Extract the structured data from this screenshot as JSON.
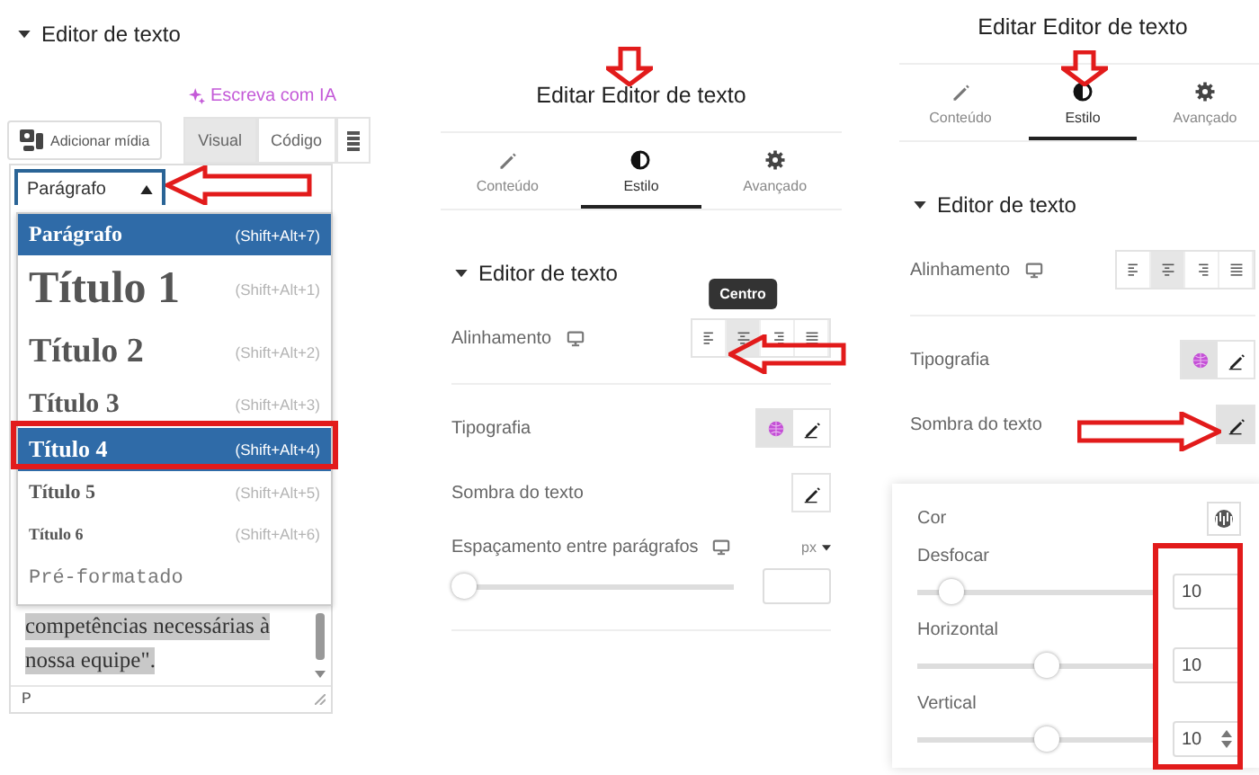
{
  "editor": {
    "title": "Editor de texto",
    "ai_link": "Escreva com IA",
    "media_button": "Adicionar mídia",
    "mode_tabs": [
      {
        "label": "Visual",
        "selected": true
      },
      {
        "label": "Código",
        "selected": false
      }
    ],
    "format_select": "Parágrafo",
    "format_menu": [
      {
        "kind": "p",
        "label": "Parágrafo",
        "shortcut": "(Shift+Alt+7)",
        "highlighted": true
      },
      {
        "kind": "h1",
        "label": "Título 1",
        "shortcut": "(Shift+Alt+1)",
        "highlighted": false
      },
      {
        "kind": "h2",
        "label": "Título 2",
        "shortcut": "(Shift+Alt+2)",
        "highlighted": false
      },
      {
        "kind": "h3",
        "label": "Título 3",
        "shortcut": "(Shift+Alt+3)",
        "highlighted": false
      },
      {
        "kind": "h4",
        "label": "Título 4",
        "shortcut": "(Shift+Alt+4)",
        "highlighted": true
      },
      {
        "kind": "h5",
        "label": "Título 5",
        "shortcut": "(Shift+Alt+5)",
        "highlighted": false
      },
      {
        "kind": "h6",
        "label": "Título 6",
        "shortcut": "(Shift+Alt+6)",
        "highlighted": false
      },
      {
        "kind": "pre",
        "label": "Pré-formatado",
        "highlighted": false
      }
    ],
    "content_lines": [
      "competências necessárias à",
      "nossa equipe\"."
    ],
    "status": "P"
  },
  "style_panels": [
    {
      "title": "Editar Editor de texto",
      "tabs": [
        {
          "kind": "content",
          "label": "Conteúdo",
          "selected": false
        },
        {
          "kind": "style",
          "label": "Estilo",
          "selected": true
        },
        {
          "kind": "advanced",
          "label": "Avançado",
          "selected": false
        }
      ],
      "section": "Editor de texto",
      "rows": [
        {
          "kind": "align",
          "label": "Alinhamento",
          "buttons": [
            {
              "kind": "left",
              "selected": false
            },
            {
              "kind": "center",
              "selected": true,
              "tooltip": "Centro"
            },
            {
              "kind": "right",
              "selected": false
            },
            {
              "kind": "justify",
              "selected": false
            }
          ]
        },
        {
          "kind": "actions",
          "label": "Tipografia",
          "buttons": [
            {
              "kind": "global",
              "active": true
            },
            {
              "kind": "edit",
              "active": false
            }
          ]
        },
        {
          "kind": "actions",
          "label": "Sombra do texto",
          "buttons": [
            {
              "kind": "edit",
              "active": false
            }
          ]
        },
        {
          "kind": "spacing",
          "label": "Espaçamento entre parágrafos",
          "unit": "px",
          "level": 0
        }
      ]
    },
    {
      "title": "Editar Editor de texto",
      "tabs": [
        {
          "kind": "content",
          "label": "Conteúdo",
          "selected": false
        },
        {
          "kind": "style",
          "label": "Estilo",
          "selected": true
        },
        {
          "kind": "advanced",
          "label": "Avançado",
          "selected": false
        }
      ],
      "section": "Editor de texto",
      "rows": [
        {
          "kind": "align",
          "label": "Alinhamento",
          "buttons": [
            {
              "kind": "left",
              "selected": false
            },
            {
              "kind": "center",
              "selected": true
            },
            {
              "kind": "right",
              "selected": false
            },
            {
              "kind": "justify",
              "selected": false
            }
          ]
        },
        {
          "kind": "actions",
          "label": "Tipografia",
          "buttons": [
            {
              "kind": "global",
              "active": true
            },
            {
              "kind": "edit",
              "active": false
            }
          ]
        },
        {
          "kind": "actions",
          "label": "Sombra do texto",
          "buttons": [
            {
              "kind": "edit",
              "active": true
            }
          ]
        },
        {
          "kind": "popover",
          "fields": [
            {
              "kind": "color",
              "label": "Cor"
            },
            {
              "kind": "slider",
              "label": "Desfocar",
              "level": 0.1,
              "value": "10",
              "stepper": false
            },
            {
              "kind": "slider",
              "label": "Horizontal",
              "level": 0.55,
              "value": "10",
              "stepper": false
            },
            {
              "kind": "slider",
              "label": "Vertical",
              "level": 0.55,
              "value": "10",
              "stepper": true
            }
          ]
        }
      ]
    }
  ]
}
